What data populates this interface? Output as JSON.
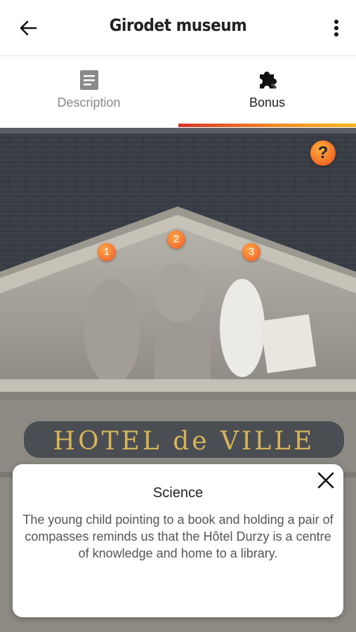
{
  "header": {
    "title": "Girodet museum",
    "back_icon": "arrow-left-icon",
    "menu_icon": "more-vertical-icon"
  },
  "tabs": [
    {
      "label": "Description",
      "icon": "document-icon",
      "active": false
    },
    {
      "label": "Bonus",
      "icon": "puzzle-piece-icon",
      "active": true
    }
  ],
  "scene": {
    "sign_text": "HOTEL de VILLE",
    "hotspots": [
      "1",
      "2",
      "3"
    ],
    "help_label": "?"
  },
  "card": {
    "title": "Science",
    "body": "The young child pointing to a book and holding a pair of compasses reminds us that the Hôtel Durzy is a centre of knowledge and home to a library."
  },
  "colors": {
    "accent_start": "#d7342a",
    "accent_end": "#f6b41d",
    "hotspot": "#ee5a24"
  }
}
